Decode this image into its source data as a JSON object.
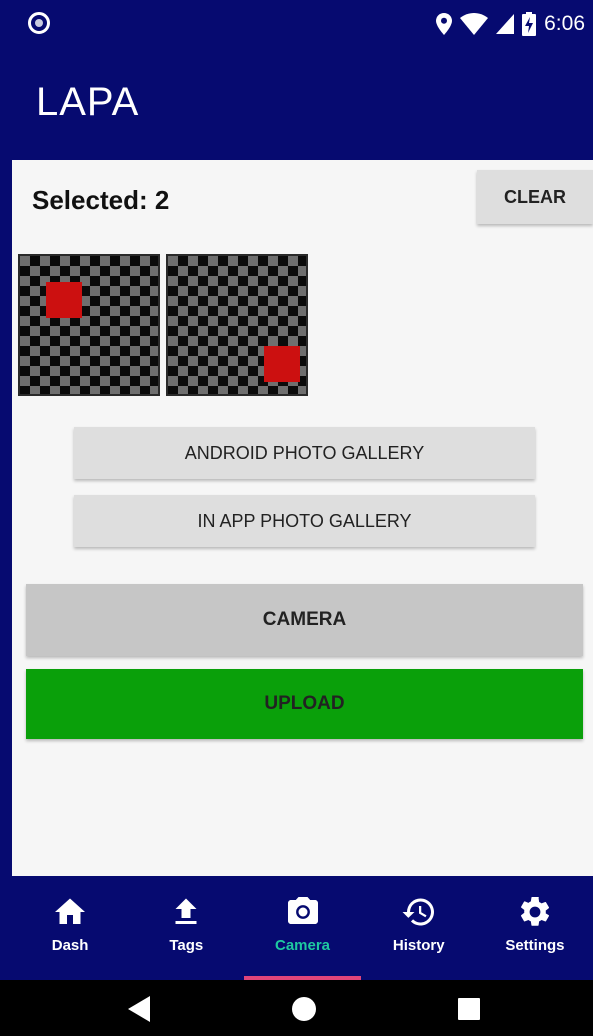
{
  "status_bar": {
    "time": "6:06",
    "icons": [
      "notification-circle-icon",
      "location-pin-icon",
      "wifi-icon",
      "signal-icon",
      "battery-charging-icon"
    ]
  },
  "app_bar": {
    "title": "LAPA"
  },
  "selection": {
    "label": "Selected: 2",
    "clear_label": "CLEAR",
    "thumbnail_count": 2
  },
  "buttons": {
    "android_gallery": "ANDROID PHOTO GALLERY",
    "in_app_gallery": "IN APP PHOTO GALLERY",
    "camera": "CAMERA",
    "upload": "UPLOAD"
  },
  "bottom_nav": {
    "items": [
      {
        "label": "Dash",
        "icon": "home-icon"
      },
      {
        "label": "Tags",
        "icon": "upload-icon"
      },
      {
        "label": "Camera",
        "icon": "camera-icon",
        "active": true
      },
      {
        "label": "History",
        "icon": "history-icon"
      },
      {
        "label": "Settings",
        "icon": "gear-icon"
      }
    ]
  },
  "system_nav": {
    "icons": [
      "back-icon",
      "home-circle-icon",
      "recents-icon"
    ]
  },
  "colors": {
    "primary": "#060a70",
    "upload_green": "#0aa00a",
    "camera_gray": "#c6c6c6",
    "active_tab_text": "#1ec9a0",
    "active_tab_indicator": "#e0457a",
    "thumbnail_marker": "#cc1010"
  }
}
